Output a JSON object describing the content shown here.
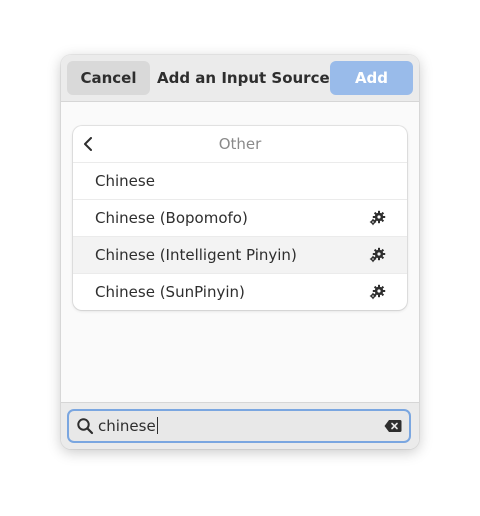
{
  "dialog": {
    "title": "Add an Input Source",
    "cancel_label": "Cancel",
    "add_label": "Add"
  },
  "list": {
    "header": "Other",
    "items": [
      {
        "label": "Chinese",
        "has_settings": false
      },
      {
        "label": "Chinese (Bopomofo)",
        "has_settings": true
      },
      {
        "label": "Chinese (Intelligent Pinyin)",
        "has_settings": true,
        "hovered": true
      },
      {
        "label": "Chinese (SunPinyin)",
        "has_settings": true
      }
    ]
  },
  "search": {
    "value": "chinese"
  },
  "icons": {
    "back": "chevron-left-icon",
    "settings": "gear-icon",
    "search": "search-icon",
    "clear": "clear-text-icon"
  },
  "colors": {
    "accent": "#99bbea",
    "focus_border": "#7aa6e0"
  }
}
